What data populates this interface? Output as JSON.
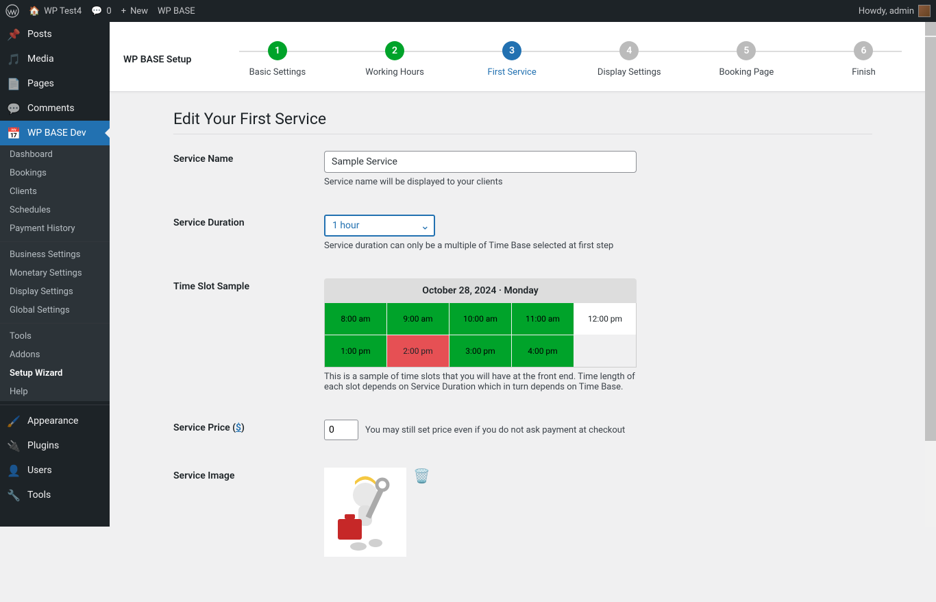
{
  "adminbar": {
    "site_name": "WP Test4",
    "comments": "0",
    "new_label": "New",
    "wpbase_label": "WP BASE",
    "howdy": "Howdy, admin"
  },
  "sidebar": {
    "items": [
      {
        "label": "Posts"
      },
      {
        "label": "Media"
      },
      {
        "label": "Pages"
      },
      {
        "label": "Comments"
      },
      {
        "label": "WP BASE Dev"
      }
    ],
    "submenu1": [
      {
        "label": "Dashboard"
      },
      {
        "label": "Bookings"
      },
      {
        "label": "Clients"
      },
      {
        "label": "Schedules"
      },
      {
        "label": "Payment History"
      }
    ],
    "submenu2": [
      {
        "label": "Business Settings"
      },
      {
        "label": "Monetary Settings"
      },
      {
        "label": "Display Settings"
      },
      {
        "label": "Global Settings"
      }
    ],
    "submenu3": [
      {
        "label": "Tools"
      },
      {
        "label": "Addons"
      },
      {
        "label": "Setup Wizard"
      },
      {
        "label": "Help"
      }
    ],
    "items2": [
      {
        "label": "Appearance"
      },
      {
        "label": "Plugins"
      },
      {
        "label": "Users"
      },
      {
        "label": "Tools"
      }
    ]
  },
  "wizard": {
    "title": "WP BASE Setup",
    "steps": [
      {
        "n": "1",
        "label": "Basic Settings"
      },
      {
        "n": "2",
        "label": "Working Hours"
      },
      {
        "n": "3",
        "label": "First Service"
      },
      {
        "n": "4",
        "label": "Display Settings"
      },
      {
        "n": "5",
        "label": "Booking Page"
      },
      {
        "n": "6",
        "label": "Finish"
      }
    ]
  },
  "form": {
    "page_title": "Edit Your First Service",
    "service_name_label": "Service Name",
    "service_name_value": "Sample Service",
    "service_name_help": "Service name will be displayed to your clients",
    "duration_label": "Service Duration",
    "duration_value": "1 hour",
    "duration_help": "Service duration can only be a multiple of Time Base selected at first step",
    "timeslot_label": "Time Slot Sample",
    "timeslot_header": "October 28, 2024 · Monday",
    "slots": [
      "8:00 am",
      "9:00 am",
      "10:00 am",
      "11:00 am",
      "12:00 pm",
      "1:00 pm",
      "2:00 pm",
      "3:00 pm",
      "4:00 pm"
    ],
    "timeslot_help": "This is a sample of time slots that you will have at the front end. Time length of each slot depends on Service Duration which in turn depends on Time Base.",
    "price_label_prefix": "Service Price (",
    "price_label_suffix": ")",
    "currency_symbol": "$",
    "price_value": "0",
    "price_help": "You may still set price even if you do not ask payment at checkout",
    "image_label": "Service Image"
  }
}
